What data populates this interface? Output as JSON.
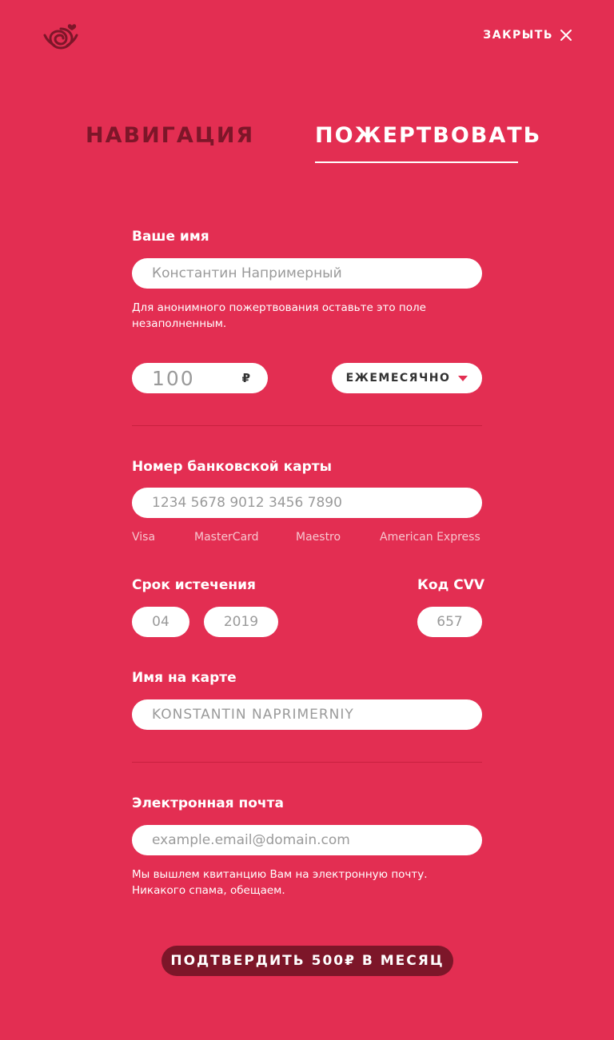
{
  "header": {
    "logo": "spiral-rose-logo",
    "close_label": "ЗАКРЫТЬ",
    "close_icon": "close-icon"
  },
  "tabs": [
    {
      "label": "НАВИГАЦИЯ",
      "active": false
    },
    {
      "label": "ПОЖЕРТВОВАТЬ",
      "active": true
    }
  ],
  "form": {
    "name": {
      "label": "Ваше имя",
      "placeholder": "Константин Напримерный",
      "hint": "Для анонимного пожертвования оставьте это поле незаполненным."
    },
    "amount": {
      "value": "100",
      "currency": "₽"
    },
    "frequency": {
      "selected": "ЕЖЕМЕСЯЧНО",
      "icon": "caret-down-icon"
    },
    "card_number": {
      "label": "Номер банковской карты",
      "placeholder": "1234 5678 9012 3456 7890",
      "brands": [
        "Visa",
        "MasterCard",
        "Maestro",
        "American Express"
      ]
    },
    "expiry": {
      "label": "Срок истечения",
      "month_placeholder": "04",
      "year_placeholder": "2019"
    },
    "cvv": {
      "label": "Код CVV",
      "placeholder": "657"
    },
    "card_name": {
      "label": "Имя на карте",
      "placeholder": "KONSTANTIN NAPRIMERNIY"
    },
    "email": {
      "label": "Электронная почта",
      "placeholder": "example.email@domain.com",
      "hint": "Мы вышлем квитанцию Вам на электронную почту. Никакого спама, обещаем."
    },
    "submit_label": "ПОДТВЕРДИТЬ 500₽ В МЕСЯЦ"
  },
  "colors": {
    "background": "#e32e52",
    "dark_accent": "#7d1629",
    "field_bg": "#ffffff",
    "placeholder": "#9a9a9a"
  }
}
